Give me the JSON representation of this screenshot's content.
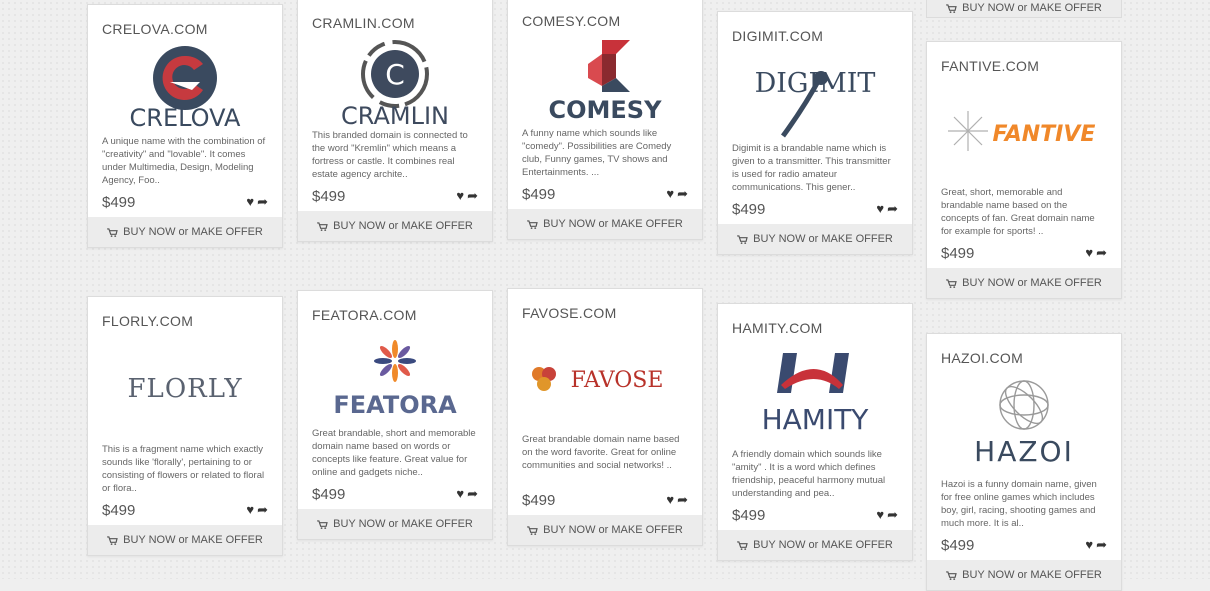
{
  "buy_label": "BUY NOW or MAKE OFFER",
  "cards": [
    {
      "domain": "CRELOVA.COM",
      "logo_text": "CRELOVA",
      "desc": "A unique name with the combination of \"creativity\" and \"lovable\". It comes under Multimedia, Design, Modeling Agency, Foo..",
      "price": "$499"
    },
    {
      "domain": "CRAMLIN.COM",
      "logo_text": "CRAMLIN",
      "desc": "This branded domain is connected to the word \"Kremlin\" which means a fortress or castle. It combines real estate agency archite..",
      "price": "$499"
    },
    {
      "domain": "COMESY.COM",
      "logo_text": "COMESY",
      "desc": "A funny name which sounds like \"comedy\". Possibilities are Comedy club, Funny games, TV shows and Entertainments. ...",
      "price": "$499"
    },
    {
      "domain": "DIGIMIT.COM",
      "logo_text": "DIGIMIT",
      "desc": "Digimit is a brandable name which is given to a transmitter. This transmitter is used for radio amateur communications. This gener..",
      "price": "$499"
    },
    {
      "domain": "FANTIVE.COM",
      "logo_text": "FANTIVE",
      "desc": "Great, short, memorable and brandable name based on the concepts of fan. Great domain name for example for sports! ..",
      "price": "$499"
    },
    {
      "domain": "FLORLY.COM",
      "logo_text": "FLORLY",
      "desc": "This is a fragment name which exactly sounds like 'florally', pertaining to or consisting of flowers or related to floral or flora..",
      "price": "$499"
    },
    {
      "domain": "FEATORA.COM",
      "logo_text": "FEATORA",
      "desc": "Great brandable, short and memorable domain name based on words or concepts like feature. Great value for online and gadgets niche..",
      "price": "$499"
    },
    {
      "domain": "FAVOSE.COM",
      "logo_text": "FAVOSE",
      "desc": "Great brandable domain name based on the word favorite. Great for online communities and social networks! ..",
      "price": "$499"
    },
    {
      "domain": "HAMITY.COM",
      "logo_text": "HAMITY",
      "desc": "A friendly domain which sounds like \"amity\" . It is a word which defines friendship, peaceful harmony mutual understanding and pea..",
      "price": "$499"
    },
    {
      "domain": "HAZOI.COM",
      "logo_text": "HAZOI",
      "desc": "Hazoi is a funny domain name, given for free online games which includes boy, girl, racing, shooting games and much more. It is al..",
      "price": "$499"
    }
  ]
}
